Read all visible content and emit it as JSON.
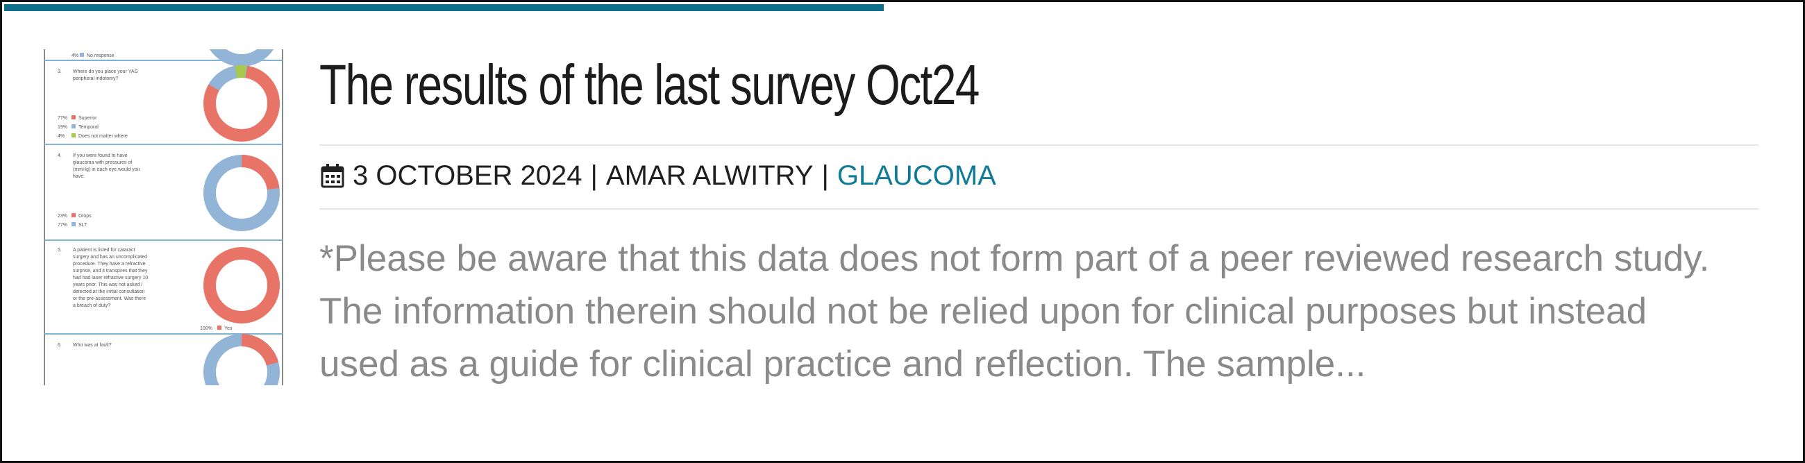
{
  "post": {
    "title": "The results of the last survey Oct24",
    "date": "3 OCTOBER 2024",
    "author": "AMAR ALWITRY",
    "category": "GLAUCOMA",
    "separator": "|",
    "excerpt_lines": [
      "*Please be aware that this data does not form part of a peer reviewed research study.",
      "The information therein should not be relied upon for clinical purposes but instead",
      "used as a guide for clinical practice and reflection. The sample..."
    ]
  },
  "thumbnail": {
    "legend_items": [
      {
        "pct": "4%",
        "label": "No response"
      },
      {
        "pct": "77%",
        "label": "Superior"
      },
      {
        "pct": "19%",
        "label": "Temporal"
      },
      {
        "pct": "4%",
        "label": "Does not matter where"
      },
      {
        "pct": "23%",
        "label": "Drops"
      },
      {
        "pct": "77%",
        "label": "SLT"
      },
      {
        "pct": "100%",
        "label": "Yes"
      }
    ],
    "questions": [
      {
        "num": "3.",
        "text": [
          "Where do you place your YAG",
          "peripheral iridotomy?"
        ]
      },
      {
        "num": "4.",
        "text": [
          "If you were found to have",
          "glaucoma with pressures of",
          "(mmHg) in each eye would you",
          "have:"
        ]
      },
      {
        "num": "5.",
        "text": [
          "A patient is listed for cataract",
          "surgery and has an uncomplicated",
          "procedure. They have a refractive",
          "surprise, and it transpires that they",
          "had had laser refractive surgery 10",
          "years prior. This was not asked /",
          "detected at the initial consultation",
          "or the pre-assessment. Was there",
          "a breach of duty?"
        ]
      },
      {
        "num": "6.",
        "text": [
          "Who was at fault?"
        ]
      }
    ]
  },
  "colors": {
    "accent": "#0e6f88",
    "link": "#0f7b98",
    "donut_red": "#e87468",
    "donut_blue": "#92b4d6",
    "donut_green": "#a9c94c"
  },
  "icons": {
    "date": "calendar-icon"
  }
}
